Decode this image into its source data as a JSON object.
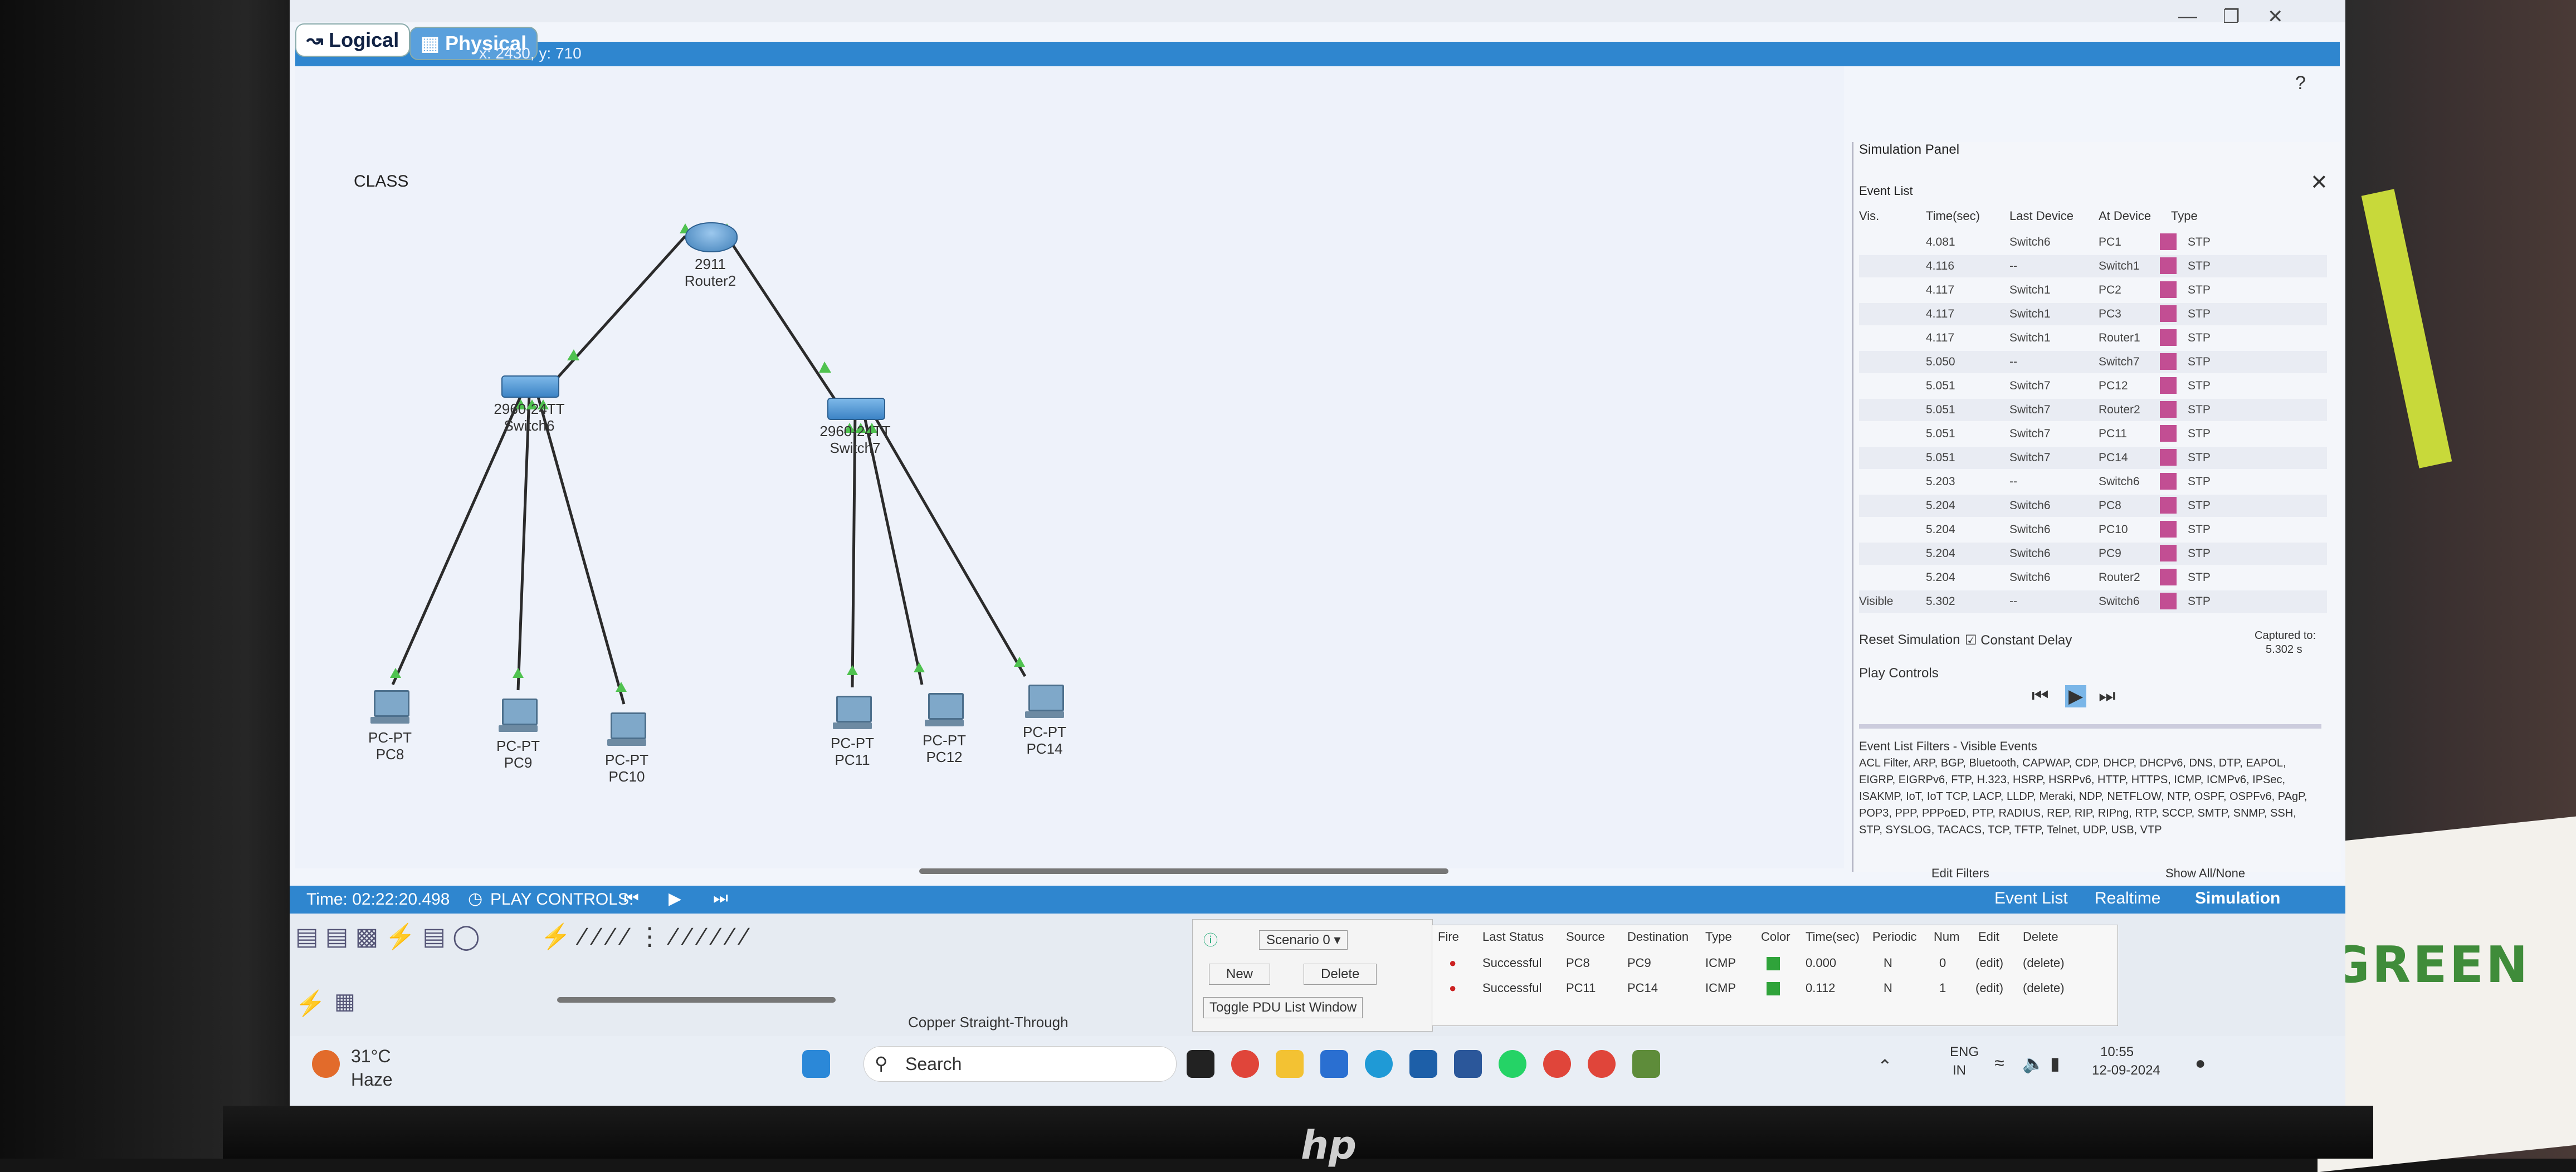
{
  "photo": {
    "brand": "hp",
    "card_word": "GREEN"
  },
  "window": {
    "modes": {
      "logical": "Logical",
      "physical": "Physical"
    },
    "coordinates": "x: 2430, y: 710",
    "help": "?"
  },
  "workspace": {
    "cluster_label": "CLASS",
    "router": {
      "model": "2911",
      "name": "Router2"
    },
    "switches": [
      {
        "model": "2960-24TT",
        "name": "Switch6"
      },
      {
        "model": "2960-24TT",
        "name": "Switch7"
      }
    ],
    "pcs": [
      {
        "type": "PC-PT",
        "name": "PC8"
      },
      {
        "type": "PC-PT",
        "name": "PC9"
      },
      {
        "type": "PC-PT",
        "name": "PC10"
      },
      {
        "type": "PC-PT",
        "name": "PC11"
      },
      {
        "type": "PC-PT",
        "name": "PC12"
      },
      {
        "type": "PC-PT",
        "name": "PC14"
      }
    ]
  },
  "simulation_panel": {
    "title": "Simulation Panel",
    "event_list_label": "Event List",
    "columns": [
      "Vis.",
      "Time(sec)",
      "Last Device",
      "At Device",
      "Type"
    ],
    "events": [
      {
        "time": "4.081",
        "last": "Switch6",
        "at": "PC1",
        "type": "STP"
      },
      {
        "time": "4.116",
        "last": "--",
        "at": "Switch1",
        "type": "STP"
      },
      {
        "time": "4.117",
        "last": "Switch1",
        "at": "PC2",
        "type": "STP"
      },
      {
        "time": "4.117",
        "last": "Switch1",
        "at": "PC3",
        "type": "STP"
      },
      {
        "time": "4.117",
        "last": "Switch1",
        "at": "Router1",
        "type": "STP"
      },
      {
        "time": "5.050",
        "last": "--",
        "at": "Switch7",
        "type": "STP"
      },
      {
        "time": "5.051",
        "last": "Switch7",
        "at": "PC12",
        "type": "STP"
      },
      {
        "time": "5.051",
        "last": "Switch7",
        "at": "Router2",
        "type": "STP"
      },
      {
        "time": "5.051",
        "last": "Switch7",
        "at": "PC11",
        "type": "STP"
      },
      {
        "time": "5.051",
        "last": "Switch7",
        "at": "PC14",
        "type": "STP"
      },
      {
        "time": "5.203",
        "last": "--",
        "at": "Switch6",
        "type": "STP"
      },
      {
        "time": "5.204",
        "last": "Switch6",
        "at": "PC8",
        "type": "STP"
      },
      {
        "time": "5.204",
        "last": "Switch6",
        "at": "PC10",
        "type": "STP"
      },
      {
        "time": "5.204",
        "last": "Switch6",
        "at": "PC9",
        "type": "STP"
      },
      {
        "time": "5.204",
        "last": "Switch6",
        "at": "Router2",
        "type": "STP"
      },
      {
        "vis": "Visible",
        "time": "5.302",
        "last": "--",
        "at": "Switch6",
        "type": "STP"
      }
    ],
    "stp_color": "#c24e93",
    "reset_simulation": "Reset Simulation",
    "constant_delay": "Constant Delay",
    "captured_label": "Captured to:",
    "captured_value": "5.302 s",
    "play_controls": "Play Controls",
    "filters_title": "Event List Filters - Visible Events",
    "filters_text": "ACL Filter, ARP, BGP, Bluetooth, CAPWAP, CDP, DHCP, DHCPv6, DNS, DTP, EAPOL, EIGRP, EIGRPv6, FTP, H.323, HSRP, HSRPv6, HTTP, HTTPS, ICMP, ICMPv6, IPSec, ISAKMP, IoT, IoT TCP, LACP, LLDP, Meraki, NDP, NETFLOW, NTP, OSPF, OSPFv6, PAgP, POP3, PPP, PPPoED, PTP, RADIUS, REP, RIP, RIPng, RTP, SCCP, SMTP, SNMP, SSH, STP, SYSLOG, TACACS, TCP, TFTP, Telnet, UDP, USB, VTP",
    "edit_filters": "Edit Filters",
    "show_all_none": "Show All/None"
  },
  "statusbar": {
    "time": "Time: 02:22:20.498",
    "play_controls": "PLAY CONTROLS:",
    "event_list": "Event List",
    "realtime": "Realtime",
    "simulation": "Simulation"
  },
  "device_toolbar": {
    "connection_label": "Copper Straight-Through"
  },
  "pdu": {
    "scenario": "Scenario 0",
    "new": "New",
    "delete": "Delete",
    "toggle": "Toggle PDU List Window",
    "columns": [
      "Fire",
      "Last Status",
      "Source",
      "Destination",
      "Type",
      "Color",
      "Time(sec)",
      "Periodic",
      "Num",
      "Edit",
      "Delete"
    ],
    "rows": [
      {
        "status": "Successful",
        "source": "PC8",
        "dest": "PC9",
        "type": "ICMP",
        "time": "0.000",
        "periodic": "N",
        "num": "0",
        "edit": "(edit)",
        "delete": "(delete)"
      },
      {
        "status": "Successful",
        "source": "PC11",
        "dest": "PC14",
        "type": "ICMP",
        "time": "0.112",
        "periodic": "N",
        "num": "1",
        "edit": "(edit)",
        "delete": "(delete)"
      }
    ],
    "pdu_color": "#2fa33a"
  },
  "taskbar": {
    "weather_temp": "31°C",
    "weather_desc": "Haze",
    "search": "Search",
    "lang": "ENG",
    "region": "IN",
    "clock_time": "10:55",
    "clock_date": "12-09-2024"
  }
}
